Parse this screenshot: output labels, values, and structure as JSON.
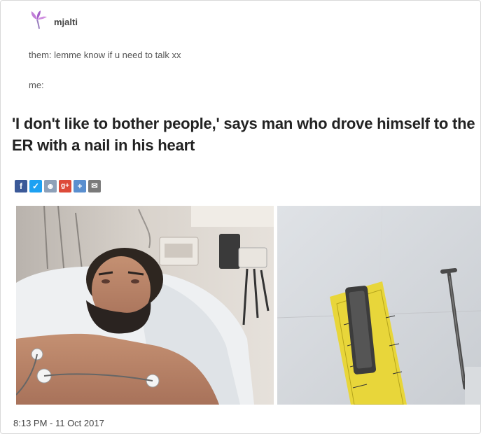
{
  "post": {
    "username": "mjalti",
    "line1": "them: lemme know if u need to talk xx",
    "line2": "me:",
    "headline": "'I don't like to bother people,' says man who drove himself to the ER with a nail in his heart",
    "timestamp": "8:13 PM - 11 Oct 2017"
  },
  "share_buttons": [
    {
      "icon": "facebook-icon",
      "glyph": "f",
      "color": "#3b5998"
    },
    {
      "icon": "twitter-icon",
      "glyph": "✓",
      "color": "#1da1f2"
    },
    {
      "icon": "reddit-icon",
      "glyph": "☻",
      "color": "#8da0b8"
    },
    {
      "icon": "google-plus-icon",
      "glyph": "g+",
      "color": "#dd4b39"
    },
    {
      "icon": "plus-icon",
      "glyph": "+",
      "color": "#5a8fcf"
    },
    {
      "icon": "email-icon",
      "glyph": "✉",
      "color": "#7a7a7a"
    }
  ],
  "colors": {
    "avatar": "#b265c9",
    "text": "#222222",
    "muted": "#555555"
  }
}
